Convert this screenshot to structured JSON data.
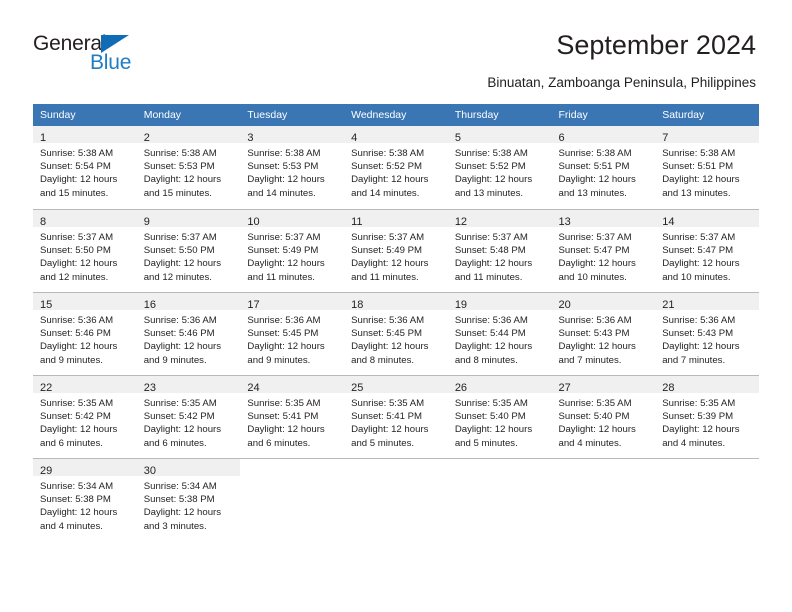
{
  "brand": {
    "name_part1": "General",
    "name_part2": "Blue",
    "logo_icon": "triangle-logo-icon",
    "accent_color": "#1f7ec4",
    "dark_color": "#231f20"
  },
  "header": {
    "title": "September 2024",
    "subtitle": "Binuatan, Zamboanga Peninsula, Philippines"
  },
  "colors": {
    "header_row_bg": "#3b76b4",
    "header_row_text": "#ffffff",
    "daynum_bar_bg": "#f0f0f0",
    "cell_border": "#b9b9b9"
  },
  "weekdays": [
    "Sunday",
    "Monday",
    "Tuesday",
    "Wednesday",
    "Thursday",
    "Friday",
    "Saturday"
  ],
  "weeks": [
    {
      "days": [
        {
          "day": "1",
          "sunrise": "Sunrise: 5:38 AM",
          "sunset": "Sunset: 5:54 PM",
          "daylight_1": "Daylight: 12 hours",
          "daylight_2": "and 15 minutes."
        },
        {
          "day": "2",
          "sunrise": "Sunrise: 5:38 AM",
          "sunset": "Sunset: 5:53 PM",
          "daylight_1": "Daylight: 12 hours",
          "daylight_2": "and 15 minutes."
        },
        {
          "day": "3",
          "sunrise": "Sunrise: 5:38 AM",
          "sunset": "Sunset: 5:53 PM",
          "daylight_1": "Daylight: 12 hours",
          "daylight_2": "and 14 minutes."
        },
        {
          "day": "4",
          "sunrise": "Sunrise: 5:38 AM",
          "sunset": "Sunset: 5:52 PM",
          "daylight_1": "Daylight: 12 hours",
          "daylight_2": "and 14 minutes."
        },
        {
          "day": "5",
          "sunrise": "Sunrise: 5:38 AM",
          "sunset": "Sunset: 5:52 PM",
          "daylight_1": "Daylight: 12 hours",
          "daylight_2": "and 13 minutes."
        },
        {
          "day": "6",
          "sunrise": "Sunrise: 5:38 AM",
          "sunset": "Sunset: 5:51 PM",
          "daylight_1": "Daylight: 12 hours",
          "daylight_2": "and 13 minutes."
        },
        {
          "day": "7",
          "sunrise": "Sunrise: 5:38 AM",
          "sunset": "Sunset: 5:51 PM",
          "daylight_1": "Daylight: 12 hours",
          "daylight_2": "and 13 minutes."
        }
      ]
    },
    {
      "days": [
        {
          "day": "8",
          "sunrise": "Sunrise: 5:37 AM",
          "sunset": "Sunset: 5:50 PM",
          "daylight_1": "Daylight: 12 hours",
          "daylight_2": "and 12 minutes."
        },
        {
          "day": "9",
          "sunrise": "Sunrise: 5:37 AM",
          "sunset": "Sunset: 5:50 PM",
          "daylight_1": "Daylight: 12 hours",
          "daylight_2": "and 12 minutes."
        },
        {
          "day": "10",
          "sunrise": "Sunrise: 5:37 AM",
          "sunset": "Sunset: 5:49 PM",
          "daylight_1": "Daylight: 12 hours",
          "daylight_2": "and 11 minutes."
        },
        {
          "day": "11",
          "sunrise": "Sunrise: 5:37 AM",
          "sunset": "Sunset: 5:49 PM",
          "daylight_1": "Daylight: 12 hours",
          "daylight_2": "and 11 minutes."
        },
        {
          "day": "12",
          "sunrise": "Sunrise: 5:37 AM",
          "sunset": "Sunset: 5:48 PM",
          "daylight_1": "Daylight: 12 hours",
          "daylight_2": "and 11 minutes."
        },
        {
          "day": "13",
          "sunrise": "Sunrise: 5:37 AM",
          "sunset": "Sunset: 5:47 PM",
          "daylight_1": "Daylight: 12 hours",
          "daylight_2": "and 10 minutes."
        },
        {
          "day": "14",
          "sunrise": "Sunrise: 5:37 AM",
          "sunset": "Sunset: 5:47 PM",
          "daylight_1": "Daylight: 12 hours",
          "daylight_2": "and 10 minutes."
        }
      ]
    },
    {
      "days": [
        {
          "day": "15",
          "sunrise": "Sunrise: 5:36 AM",
          "sunset": "Sunset: 5:46 PM",
          "daylight_1": "Daylight: 12 hours",
          "daylight_2": "and 9 minutes."
        },
        {
          "day": "16",
          "sunrise": "Sunrise: 5:36 AM",
          "sunset": "Sunset: 5:46 PM",
          "daylight_1": "Daylight: 12 hours",
          "daylight_2": "and 9 minutes."
        },
        {
          "day": "17",
          "sunrise": "Sunrise: 5:36 AM",
          "sunset": "Sunset: 5:45 PM",
          "daylight_1": "Daylight: 12 hours",
          "daylight_2": "and 9 minutes."
        },
        {
          "day": "18",
          "sunrise": "Sunrise: 5:36 AM",
          "sunset": "Sunset: 5:45 PM",
          "daylight_1": "Daylight: 12 hours",
          "daylight_2": "and 8 minutes."
        },
        {
          "day": "19",
          "sunrise": "Sunrise: 5:36 AM",
          "sunset": "Sunset: 5:44 PM",
          "daylight_1": "Daylight: 12 hours",
          "daylight_2": "and 8 minutes."
        },
        {
          "day": "20",
          "sunrise": "Sunrise: 5:36 AM",
          "sunset": "Sunset: 5:43 PM",
          "daylight_1": "Daylight: 12 hours",
          "daylight_2": "and 7 minutes."
        },
        {
          "day": "21",
          "sunrise": "Sunrise: 5:36 AM",
          "sunset": "Sunset: 5:43 PM",
          "daylight_1": "Daylight: 12 hours",
          "daylight_2": "and 7 minutes."
        }
      ]
    },
    {
      "days": [
        {
          "day": "22",
          "sunrise": "Sunrise: 5:35 AM",
          "sunset": "Sunset: 5:42 PM",
          "daylight_1": "Daylight: 12 hours",
          "daylight_2": "and 6 minutes."
        },
        {
          "day": "23",
          "sunrise": "Sunrise: 5:35 AM",
          "sunset": "Sunset: 5:42 PM",
          "daylight_1": "Daylight: 12 hours",
          "daylight_2": "and 6 minutes."
        },
        {
          "day": "24",
          "sunrise": "Sunrise: 5:35 AM",
          "sunset": "Sunset: 5:41 PM",
          "daylight_1": "Daylight: 12 hours",
          "daylight_2": "and 6 minutes."
        },
        {
          "day": "25",
          "sunrise": "Sunrise: 5:35 AM",
          "sunset": "Sunset: 5:41 PM",
          "daylight_1": "Daylight: 12 hours",
          "daylight_2": "and 5 minutes."
        },
        {
          "day": "26",
          "sunrise": "Sunrise: 5:35 AM",
          "sunset": "Sunset: 5:40 PM",
          "daylight_1": "Daylight: 12 hours",
          "daylight_2": "and 5 minutes."
        },
        {
          "day": "27",
          "sunrise": "Sunrise: 5:35 AM",
          "sunset": "Sunset: 5:40 PM",
          "daylight_1": "Daylight: 12 hours",
          "daylight_2": "and 4 minutes."
        },
        {
          "day": "28",
          "sunrise": "Sunrise: 5:35 AM",
          "sunset": "Sunset: 5:39 PM",
          "daylight_1": "Daylight: 12 hours",
          "daylight_2": "and 4 minutes."
        }
      ]
    },
    {
      "days": [
        {
          "day": "29",
          "sunrise": "Sunrise: 5:34 AM",
          "sunset": "Sunset: 5:38 PM",
          "daylight_1": "Daylight: 12 hours",
          "daylight_2": "and 4 minutes."
        },
        {
          "day": "30",
          "sunrise": "Sunrise: 5:34 AM",
          "sunset": "Sunset: 5:38 PM",
          "daylight_1": "Daylight: 12 hours",
          "daylight_2": "and 3 minutes."
        },
        {
          "day": "",
          "sunrise": "",
          "sunset": "",
          "daylight_1": "",
          "daylight_2": ""
        },
        {
          "day": "",
          "sunrise": "",
          "sunset": "",
          "daylight_1": "",
          "daylight_2": ""
        },
        {
          "day": "",
          "sunrise": "",
          "sunset": "",
          "daylight_1": "",
          "daylight_2": ""
        },
        {
          "day": "",
          "sunrise": "",
          "sunset": "",
          "daylight_1": "",
          "daylight_2": ""
        },
        {
          "day": "",
          "sunrise": "",
          "sunset": "",
          "daylight_1": "",
          "daylight_2": ""
        }
      ]
    }
  ]
}
